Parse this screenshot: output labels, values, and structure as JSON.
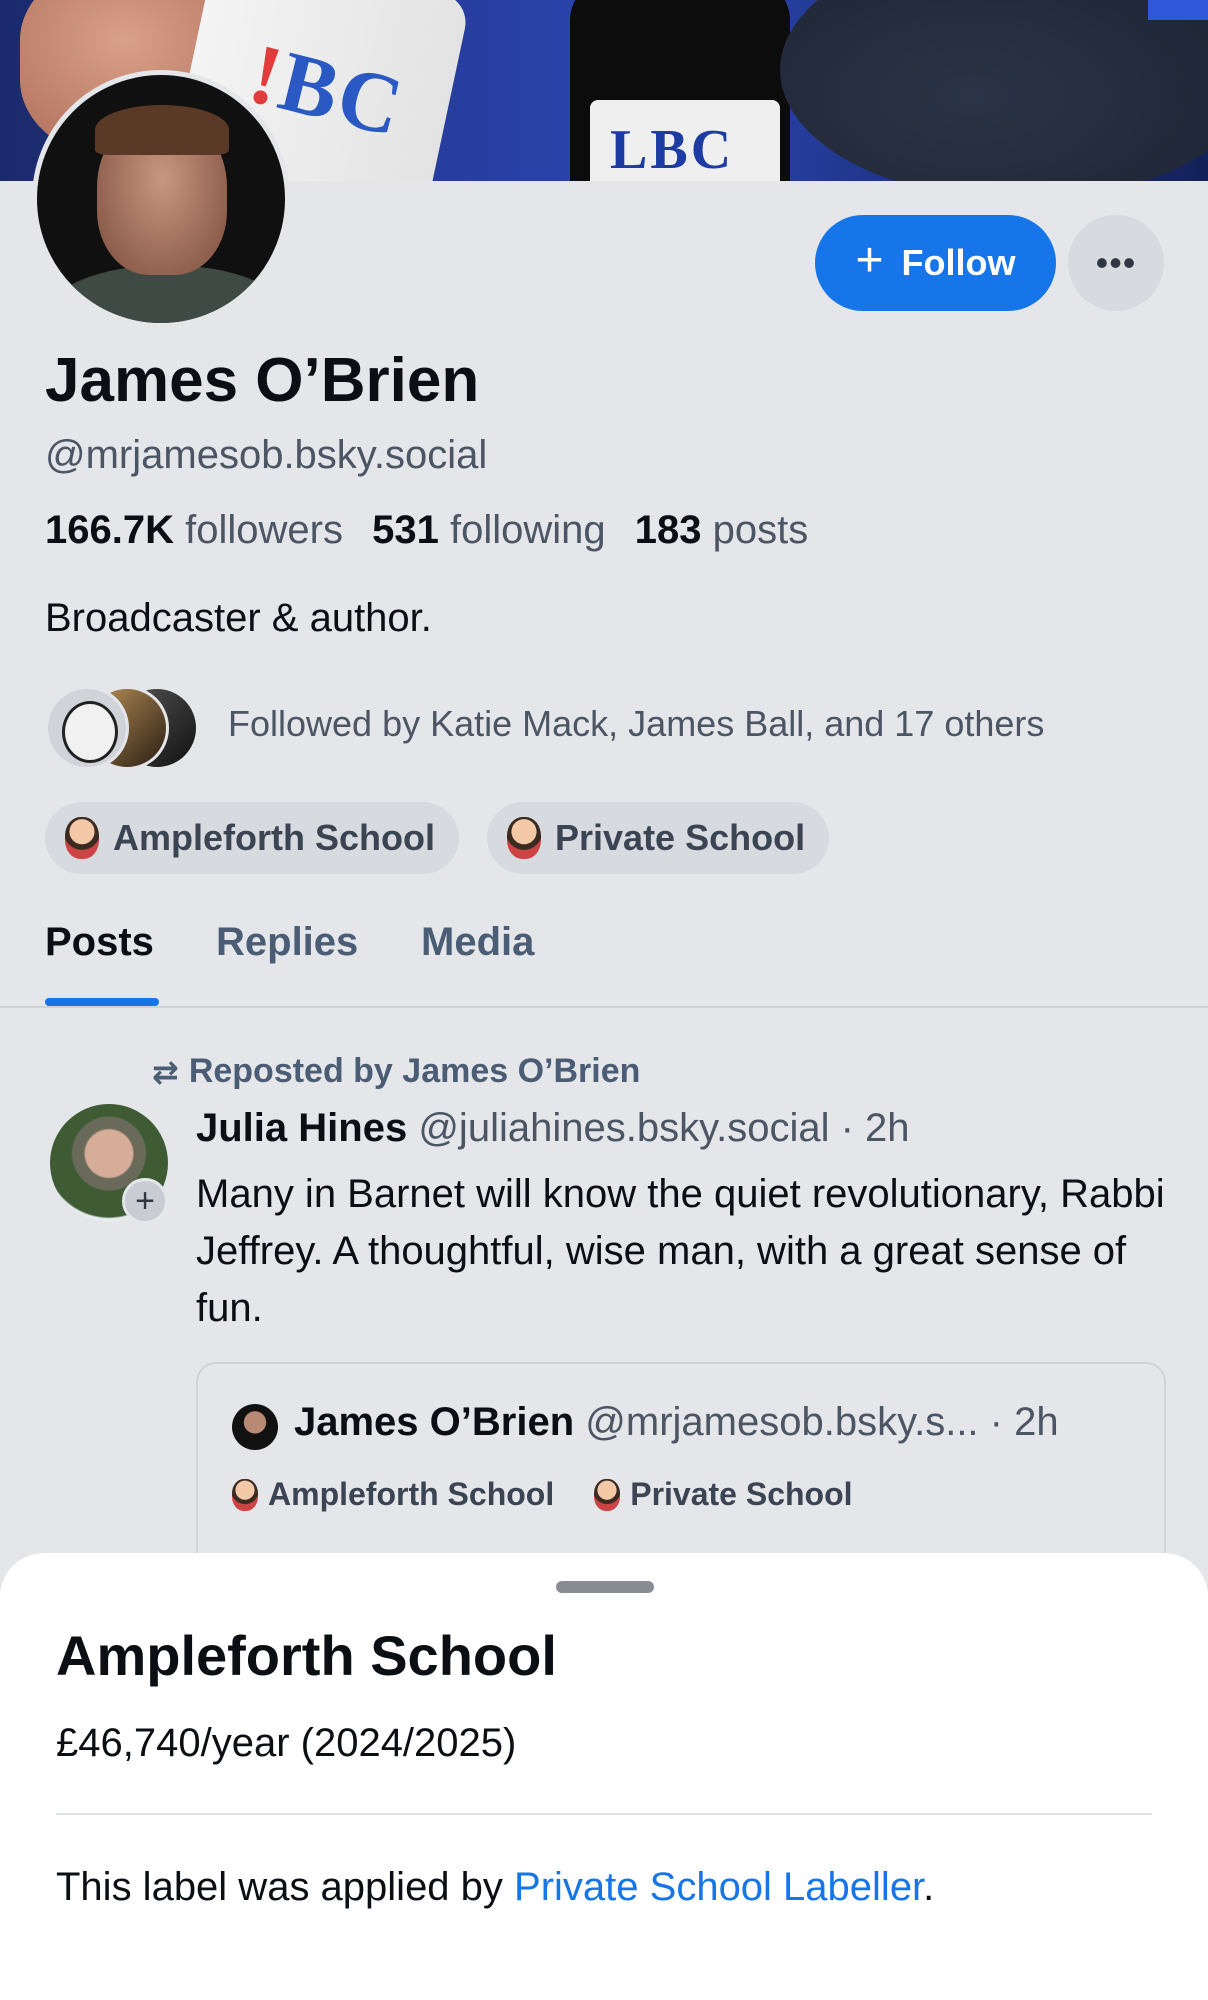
{
  "profile": {
    "display_name": "James O’Brien",
    "handle": "@mrjamesob.bsky.social",
    "followers_count": "166.7K",
    "followers_label": "followers",
    "following_count": "531",
    "following_label": "following",
    "posts_count": "183",
    "posts_label": "posts",
    "bio": "Broadcaster & author.",
    "followed_by": "Followed by Katie Mack, James Ball, and 17 others",
    "labels": [
      "Ampleforth School",
      "Private School"
    ]
  },
  "banner": {
    "mug_text_1": "BC",
    "mug_text_2": "LBC"
  },
  "actions": {
    "follow_label": "Follow",
    "follow_icon": "+",
    "more_icon": "•••"
  },
  "tabs": [
    {
      "label": "Posts",
      "active": true
    },
    {
      "label": "Replies",
      "active": false
    },
    {
      "label": "Media",
      "active": false
    }
  ],
  "feed": {
    "repost_icon": "⇄",
    "repost_text": "Reposted by James O’Brien",
    "post": {
      "author_name": "Julia Hines",
      "author_handle": "@juliahines.bsky.social",
      "time": "· 2h",
      "text": "Many in Barnet will know the quiet revolutionary, Rabbi Jeffrey. A thoughtful, wise man, with a great sense of fun.",
      "add_icon": "+",
      "quote": {
        "author_name": "James O’Brien",
        "author_handle": "@mrjamesob.bsky.s...",
        "time": "· 2h",
        "labels": [
          "Ampleforth School",
          "Private School"
        ]
      }
    }
  },
  "sheet": {
    "title": "Ampleforth School",
    "detail": "£46,740/year (2024/2025)",
    "footer_prefix": "This label was applied by ",
    "footer_link": "Private School Labeller",
    "footer_suffix": "."
  },
  "colors": {
    "accent": "#1675e8",
    "background": "#e4e6ea",
    "sheet": "#ffffff"
  }
}
